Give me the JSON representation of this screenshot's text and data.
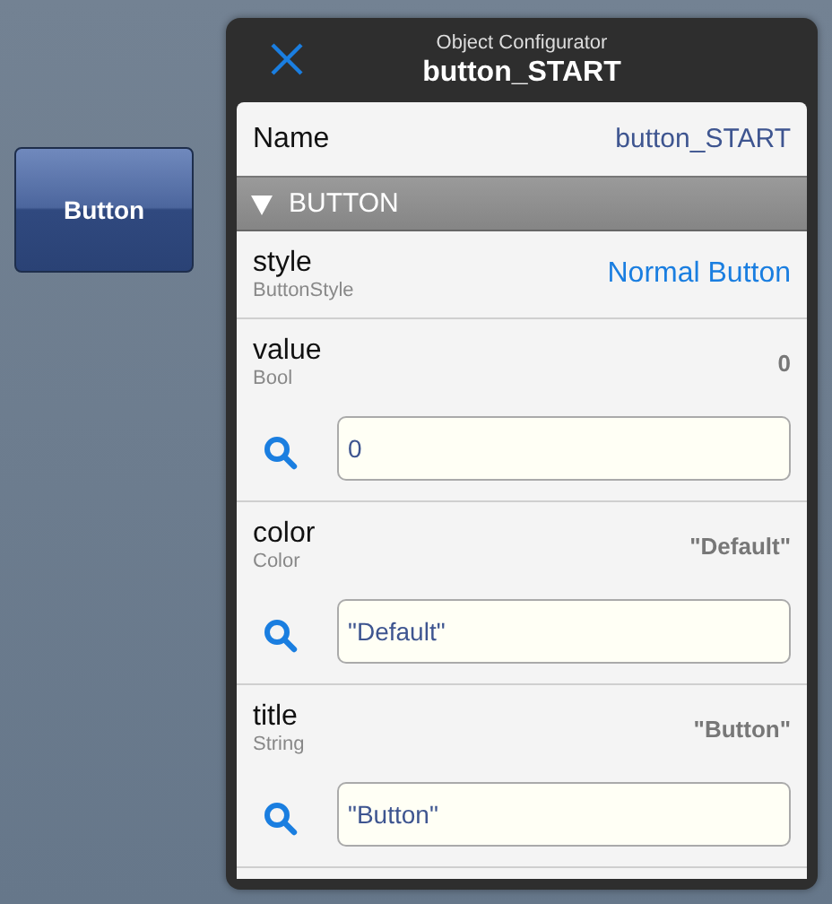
{
  "canvas": {
    "button": "Button"
  },
  "configurator": {
    "subtitle": "Object Configurator",
    "title": "button_START"
  },
  "name_row": {
    "label": "Name",
    "value": "button_START"
  },
  "section": {
    "title": "BUTTON",
    "expanded": true
  },
  "properties": [
    {
      "kind": "choice",
      "name": "style",
      "type": "ButtonStyle",
      "value": "Normal Button"
    },
    {
      "kind": "editable",
      "name": "value",
      "type": "Bool",
      "value": "0",
      "input": "0"
    },
    {
      "kind": "editable",
      "name": "color",
      "type": "Color",
      "value": "\"Default\"",
      "input": "\"Default\""
    },
    {
      "kind": "editable",
      "name": "title",
      "type": "String",
      "value": "\"Button\"",
      "input": "\"Button\""
    }
  ]
}
